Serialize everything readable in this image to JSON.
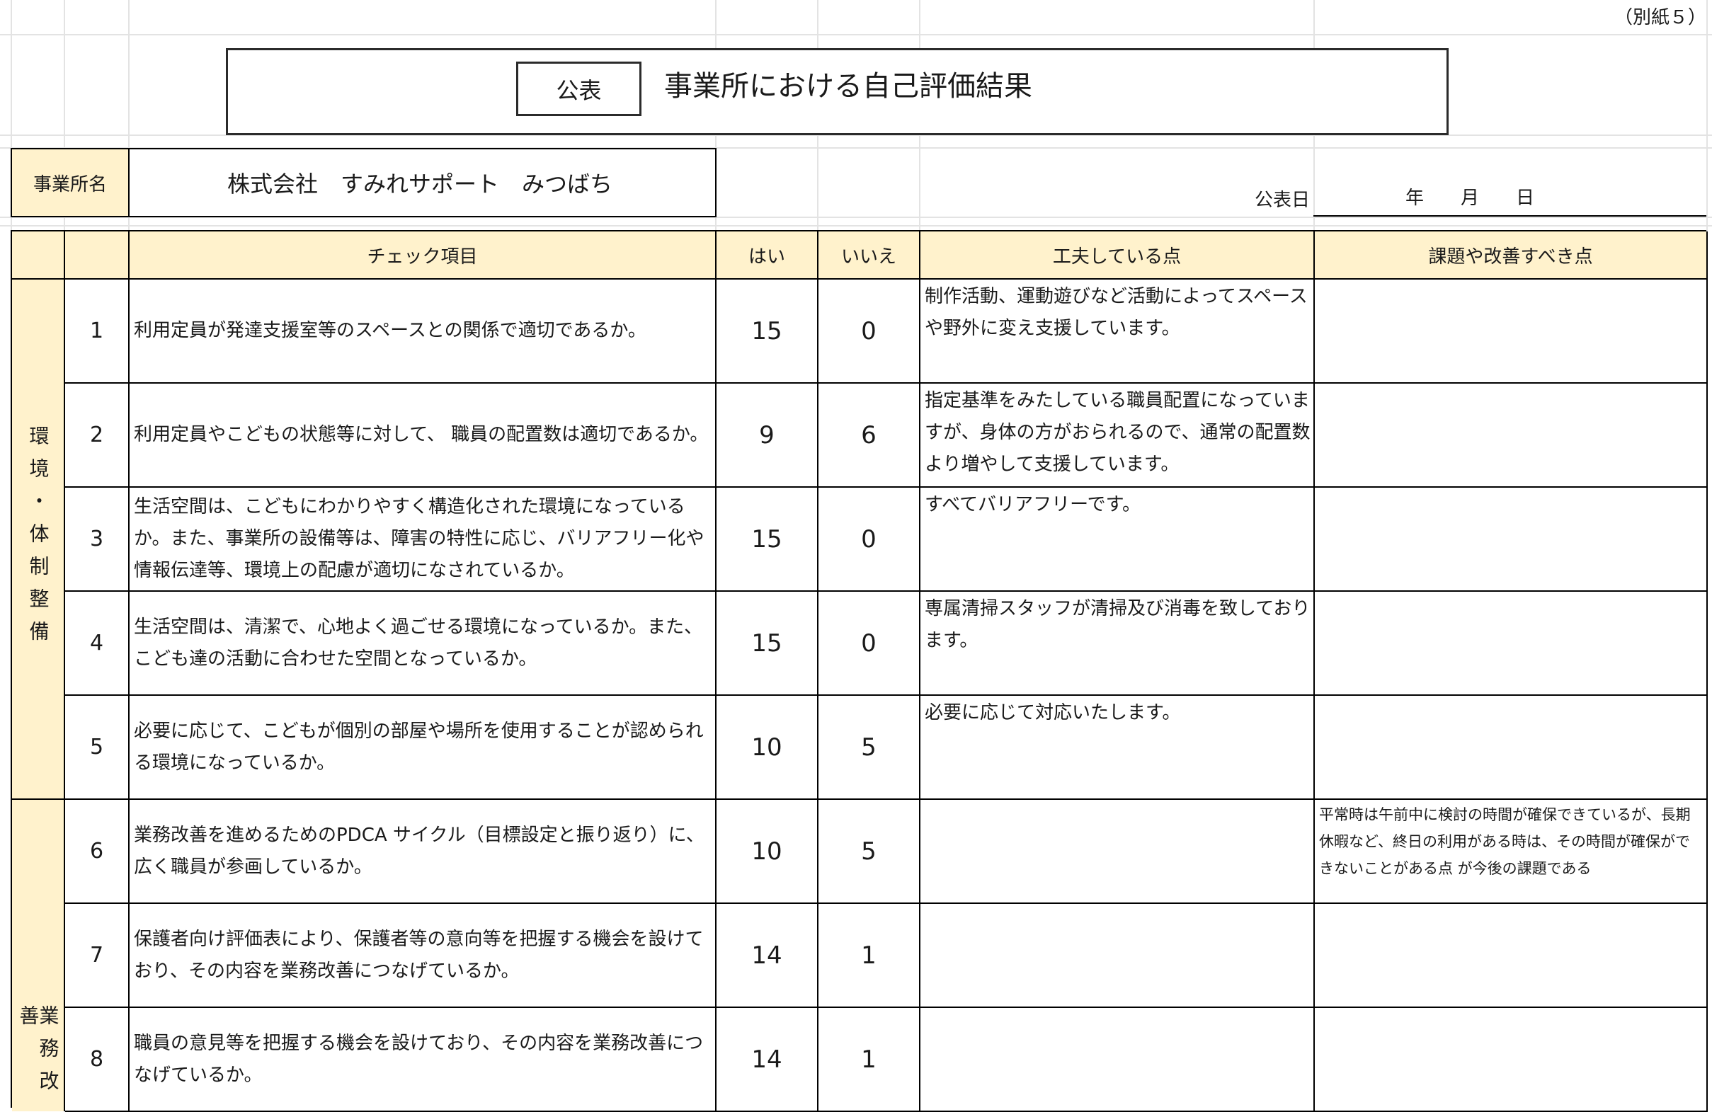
{
  "annex_label": "（別紙５）",
  "header": {
    "badge": "公表",
    "title": "事業所における自己評価結果"
  },
  "office": {
    "label": "事業所名",
    "name": "株式会社　すみれサポート　みつばち"
  },
  "publication": {
    "label": "公表日",
    "date_placeholder": "年　　月　　日"
  },
  "columns": {
    "check_item": "チェック項目",
    "yes": "はい",
    "no": "いいえ",
    "innovations": "工夫している点",
    "issues": "課題や改善すべき点"
  },
  "categories": {
    "environment": "環境・体制整備",
    "work": "業務改善"
  },
  "rows": [
    {
      "no": "1",
      "item": "利用定員が発達支援室等のスペースとの関係で適切であるか。",
      "yes": "15",
      "no_count": "0",
      "innovation": "制作活動、運動遊びなど活動によってスペースや野外に変え支援しています。",
      "issue": ""
    },
    {
      "no": "2",
      "item": "利用定員やこどもの状態等に対して、 職員の配置数は適切であるか。",
      "yes": "9",
      "no_count": "6",
      "innovation": "指定基準をみたしている職員配置になっていますが、身体の方がおられるので、通常の配置数より増やして支援しています。",
      "issue": ""
    },
    {
      "no": "3",
      "item": "生活空間は、こどもにわかりやすく構造化された環境になっているか。また、事業所の設備等は、障害の特性に応じ、バリアフリー化や情報伝達等、環境上の配慮が適切になされているか。",
      "yes": "15",
      "no_count": "0",
      "innovation": "すべてバリアフリーです。",
      "issue": ""
    },
    {
      "no": "4",
      "item": "生活空間は、清潔で、心地よく過ごせる環境になっているか。また、こども達の活動に合わせた空間となっているか。",
      "yes": "15",
      "no_count": "0",
      "innovation": "専属清掃スタッフが清掃及び消毒を致しております。",
      "issue": ""
    },
    {
      "no": "5",
      "item": "必要に応じて、こどもが個別の部屋や場所を使用することが認められる環境になっているか。",
      "yes": "10",
      "no_count": "5",
      "innovation": "必要に応じて対応いたします。",
      "issue": ""
    },
    {
      "no": "6",
      "item": "業務改善を進めるためのPDCA サイクル（目標設定と振り返り）に、広く職員が参画しているか。",
      "yes": "10",
      "no_count": "5",
      "innovation": "",
      "issue": "平常時は午前中に検討の時間が確保できているが、長期休暇など、終日の利用がある時は、その時間が確保ができないことがある点 が今後の課題である"
    },
    {
      "no": "7",
      "item": "保護者向け評価表により、保護者等の意向等を把握する機会を設けており、その内容を業務改善につなげているか。",
      "yes": "14",
      "no_count": "1",
      "innovation": "",
      "issue": ""
    },
    {
      "no": "8",
      "item": "職員の意見等を把握する機会を設けており、その内容を業務改善につなげているか。",
      "yes": "14",
      "no_count": "1",
      "innovation": "",
      "issue": ""
    }
  ]
}
